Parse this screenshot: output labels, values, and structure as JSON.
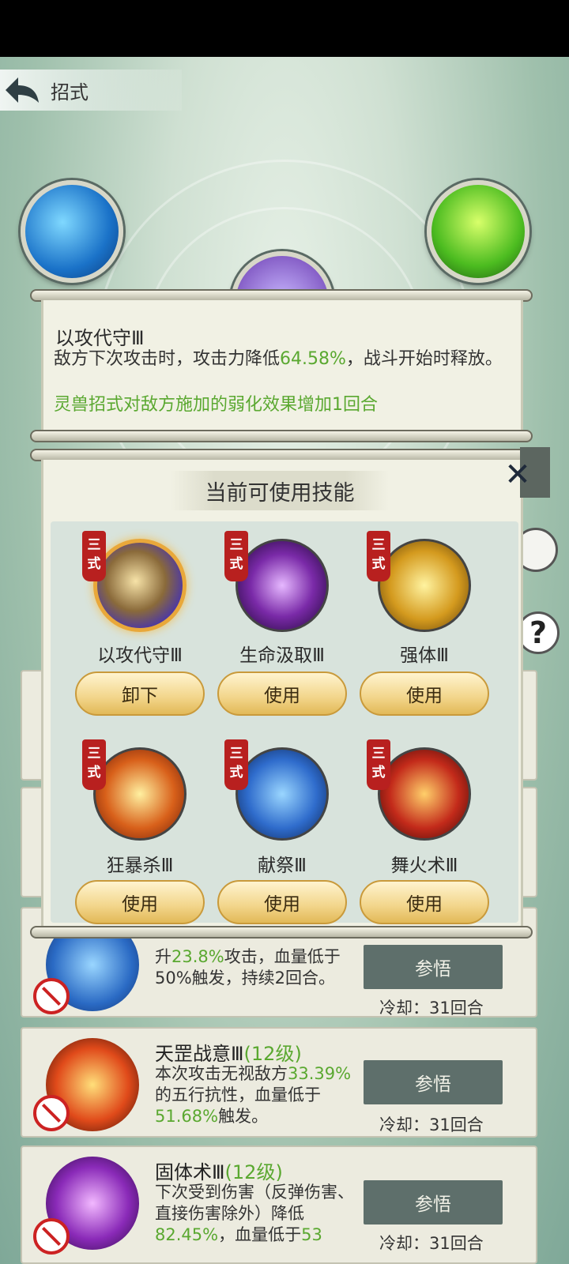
{
  "header": {
    "title": "招式"
  },
  "tooltip": {
    "skill_name": "以攻代守Ⅲ",
    "desc_prefix": "敌方下次攻击时，攻击力降低",
    "desc_value": "64.58%",
    "desc_suffix": "，战斗开始时释放。",
    "extra": "灵兽招式对敌方施加的弱化效果增加1回合"
  },
  "popup": {
    "title": "当前可使用技能",
    "tag_text": "三式",
    "skills": [
      {
        "name": "以攻代守Ⅲ",
        "button": "卸下",
        "icon": "shield-icon",
        "color": "#8a6a3a"
      },
      {
        "name": "生命汲取Ⅲ",
        "button": "使用",
        "icon": "dark-hand-icon",
        "color": "#7a2aa8"
      },
      {
        "name": "强体Ⅲ",
        "button": "使用",
        "icon": "meditate-icon",
        "color": "#d49a1e"
      },
      {
        "name": "狂暴杀Ⅲ",
        "button": "使用",
        "icon": "blade-icon",
        "color": "#d8601a"
      },
      {
        "name": "献祭Ⅲ",
        "button": "使用",
        "icon": "whirlwind-icon",
        "color": "#2f6ccc"
      },
      {
        "name": "舞火术Ⅲ",
        "button": "使用",
        "icon": "fire-swirl-icon",
        "color": "#c32a1a"
      }
    ]
  },
  "list": [
    {
      "title": "",
      "level": "",
      "desc_a": "升",
      "value_a": "23.8%",
      "desc_b": "攻击，血量低于50%触发，持续2回合。",
      "button": "参悟",
      "cooldown": "冷却：31回合",
      "color": "#2a6ac4"
    },
    {
      "title": "天罡战意Ⅲ",
      "level": "(12级)",
      "desc_a": "本次攻击无视敌方",
      "value_a": "33.39%",
      "desc_b": "的五行抗性，血量低于",
      "value_b": "51.68%",
      "desc_c": "触发。",
      "button": "参悟",
      "cooldown": "冷却：31回合",
      "color": "#c8321c"
    },
    {
      "title": "固体术Ⅲ",
      "level": "(12级)",
      "desc_a": "下次受到伤害（反弹伤害、直接伤害除外）降低",
      "value_a": "82.45%",
      "desc_b": "，血量低于",
      "value_b": "53",
      "button": "参悟",
      "cooldown": "冷却：31回合",
      "color": "#8a2ab8"
    }
  ]
}
